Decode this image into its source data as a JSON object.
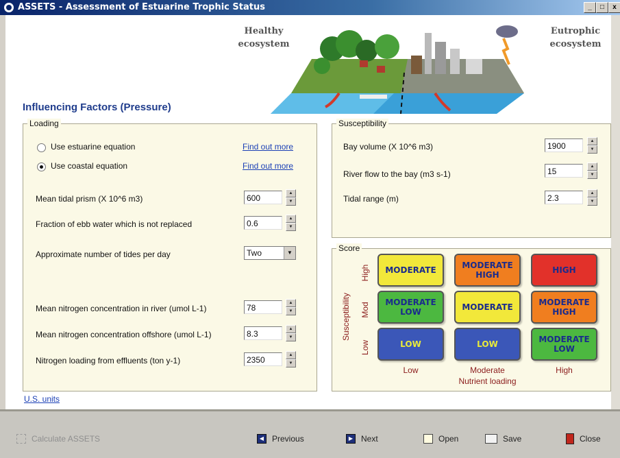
{
  "window": {
    "title": "ASSETS - Assessment of Estuarine Trophic Status",
    "controls": [
      "_",
      "□",
      "x"
    ]
  },
  "banner": {
    "healthy_label": [
      "Healthy",
      "ecosystem"
    ],
    "eutrophic_label": [
      "Eutrophic",
      "ecosystem"
    ]
  },
  "section_title": "Influencing Factors (Pressure)",
  "loading": {
    "legend": "Loading",
    "radio_estuarine": {
      "label": "Use estuarine equation",
      "selected": false
    },
    "radio_coastal": {
      "label": "Use coastal equation",
      "selected": true
    },
    "find_out_more": "Find out more",
    "fields": [
      {
        "label": "Mean tidal prism (X 10^6 m3)",
        "value": "600"
      },
      {
        "label": "Fraction of ebb water which is not replaced",
        "value": "0.6"
      },
      {
        "label": "Approximate number of tides per day",
        "value": "Two"
      },
      {
        "label": "Mean nitrogen concentration in river (umol L-1)",
        "value": "78"
      },
      {
        "label": "Mean nitrogen concentration offshore (umol L-1)",
        "value": "8.3"
      },
      {
        "label": "Nitrogen loading from effluents (ton y-1)",
        "value": "2350"
      }
    ]
  },
  "susceptibility": {
    "legend": "Susceptibility",
    "fields": [
      {
        "label": "Bay volume (X 10^6 m3)",
        "value": "1900"
      },
      {
        "label": "River flow to the bay (m3 s-1)",
        "value": "15"
      },
      {
        "label": "Tidal range (m)",
        "value": "2.3"
      }
    ]
  },
  "score": {
    "legend": "Score",
    "y_axis_title": "Susceptibility",
    "y_levels": [
      "High",
      "Mod",
      "Low"
    ],
    "x_levels": [
      "Low",
      "Moderate",
      "High"
    ],
    "x_axis_title": "Nutrient loading",
    "cells": [
      {
        "text": "MODERATE",
        "color": "#f2e83a"
      },
      {
        "text": "MODERATE HIGH",
        "color": "#f07e1f"
      },
      {
        "text": "HIGH",
        "color": "#e2312a"
      },
      {
        "text": "MODERATE LOW",
        "color": "#4cb840"
      },
      {
        "text": "MODERATE",
        "color": "#f2e83a"
      },
      {
        "text": "MODERATE HIGH",
        "color": "#f07e1f"
      },
      {
        "text": "LOW",
        "color": "#3b57b8"
      },
      {
        "text": "LOW",
        "color": "#3b57b8"
      },
      {
        "text": "MODERATE LOW",
        "color": "#4cb840"
      }
    ]
  },
  "us_units_link": "U.S. units",
  "toolbar": {
    "calculate": "Calculate ASSETS",
    "previous": "Previous",
    "next": "Next",
    "open": "Open",
    "save": "Save",
    "close": "Close"
  },
  "colors": {
    "title_blue": "#1f3c8c",
    "panel_bg": "#fbf9e6",
    "axis_red": "#8a1b1b"
  }
}
